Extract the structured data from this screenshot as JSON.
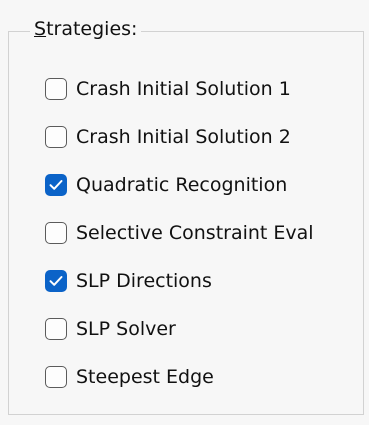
{
  "groupbox": {
    "title_first_letter": "S",
    "title_rest": "trategies:"
  },
  "strategies": [
    {
      "label": "Crash Initial Solution 1",
      "checked": false
    },
    {
      "label": "Crash Initial Solution 2",
      "checked": false
    },
    {
      "label": "Quadratic Recognition",
      "checked": true
    },
    {
      "label": "Selective Constraint Eval",
      "checked": false
    },
    {
      "label": "SLP Directions",
      "checked": true
    },
    {
      "label": "SLP Solver",
      "checked": false
    },
    {
      "label": "Steepest Edge",
      "checked": false
    }
  ],
  "colors": {
    "checked_fill": "#0b63c8",
    "unchecked_border": "#5b5b5b",
    "background": "#f7f7f7"
  },
  "icons": {
    "check": "checkmark-icon"
  }
}
